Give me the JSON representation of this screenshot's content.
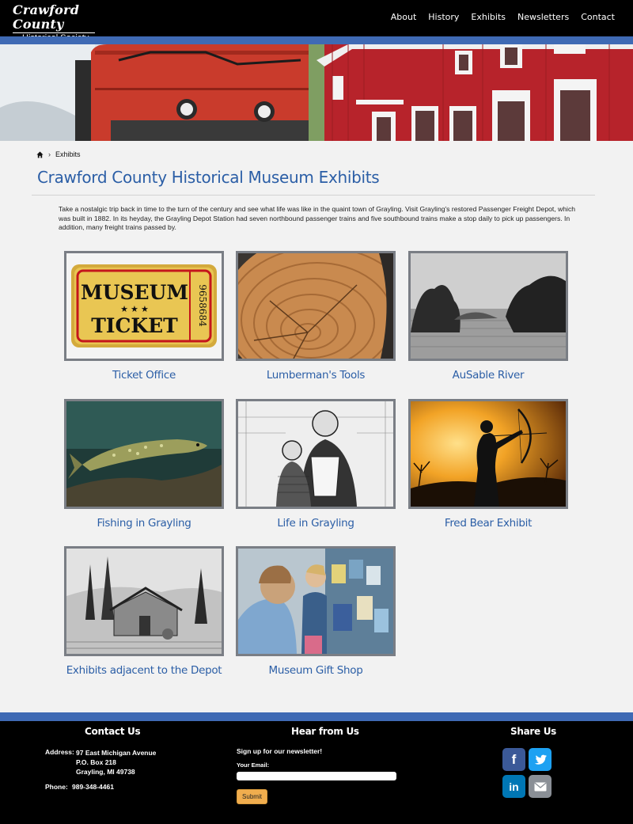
{
  "header": {
    "logo_script": "Crawford County",
    "logo_sub": "Historical Society",
    "nav": [
      "About",
      "History",
      "Exhibits",
      "Newsletters",
      "Contact"
    ]
  },
  "breadcrumb": {
    "home_icon": "home-icon",
    "current": "Exhibits"
  },
  "page": {
    "title": "Crawford County Historical Museum Exhibits",
    "intro": "Take a nostalgic trip back in time to the turn of the century and see what life was like in the quaint town of Grayling. Visit Grayling's restored Passenger Freight Depot, which was built in 1882. In its heyday, the Grayling Depot Station had seven northbound passenger trains and five southbound trains make a stop daily to pick up passengers. In addition, many freight trains passed by."
  },
  "ticket_image": {
    "line1": "MUSEUM",
    "stars": "★ ★ ★",
    "line2": "TICKET",
    "number": "9658684"
  },
  "exhibits": [
    {
      "title": "Ticket Office"
    },
    {
      "title": "Lumberman's Tools"
    },
    {
      "title": "AuSable River"
    },
    {
      "title": "Fishing in Grayling"
    },
    {
      "title": "Life in Grayling"
    },
    {
      "title": "Fred Bear Exhibit"
    },
    {
      "title": "Exhibits adjacent to the Depot"
    },
    {
      "title": "Museum Gift Shop"
    }
  ],
  "footer": {
    "contact_title": "Contact Us",
    "address_label": "Address:",
    "address_lines": [
      "97 East Michigan Avenue",
      "P.O. Box 218",
      "Grayling, MI 49738"
    ],
    "phone_label": "Phone:",
    "phone": "989-348-4461",
    "newsletter_title": "Hear from Us",
    "newsletter_text": "Sign up for our newsletter!",
    "email_label": "Your Email:",
    "email_value": "",
    "submit_label": "Submit",
    "share_title": "Share Us",
    "social": [
      {
        "name": "facebook",
        "glyph": "f",
        "color": "#3b5998"
      },
      {
        "name": "twitter",
        "glyph": "t",
        "color": "#1da1f2"
      },
      {
        "name": "linkedin",
        "glyph": "in",
        "color": "#0077b5"
      },
      {
        "name": "email",
        "glyph": "✉",
        "color": "#8a8f96"
      }
    ]
  },
  "colors": {
    "accent_blue": "#3f6ab4",
    "link_blue": "#2b5ea6",
    "submit": "#f0ad4e"
  }
}
